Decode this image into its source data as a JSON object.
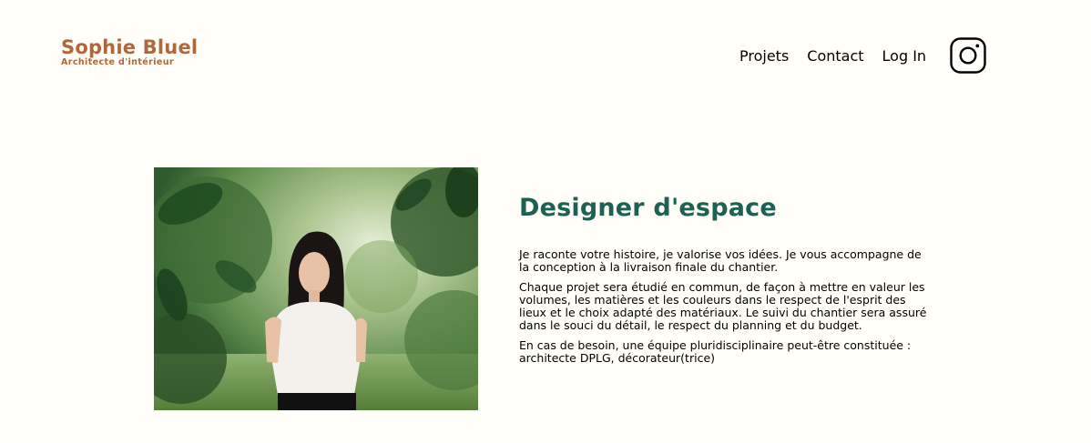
{
  "header": {
    "logo_title": "Sophie Bluel",
    "logo_subtitle": "Architecte d'intérieur",
    "nav": [
      {
        "label": "Projets"
      },
      {
        "label": "Contact"
      },
      {
        "label": "Log In"
      }
    ],
    "instagram_icon": "instagram-icon"
  },
  "intro": {
    "title": "Designer d'espace",
    "paragraphs": [
      "Je raconte votre histoire, je valorise vos idées. Je vous accompagne de la conception à la livraison finale du chantier.",
      "Chaque projet sera étudié en commun, de façon à mettre en valeur les volumes, les matières et les couleurs dans le respect de l'esprit des lieux et le choix adapté des matériaux. Le suivi du chantier sera assuré dans le souci du détail, le respect du planning et du budget.",
      "En cas de besoin, une équipe pluridisciplinaire peut-être constituée : architecte DPLG, décorateur(trice)"
    ]
  },
  "colors": {
    "brand": "#B1663C",
    "title": "#1D6154",
    "background": "#FFFEF8"
  }
}
